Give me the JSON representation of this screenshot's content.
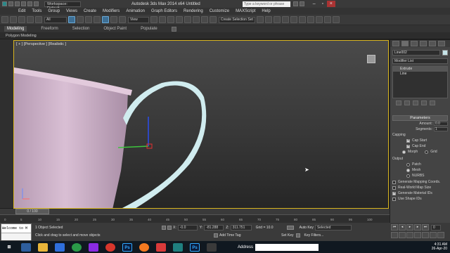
{
  "window": {
    "workspace": "Workspace: Default",
    "title": "Autodesk 3ds Max 2014 x64     Untitled",
    "search_placeholder": "Type a keyword or phrase"
  },
  "menu": [
    "Edit",
    "Tools",
    "Group",
    "Views",
    "Create",
    "Modifiers",
    "Animation",
    "Graph Editors",
    "Rendering",
    "Customize",
    "MAXScript",
    "Help"
  ],
  "toolbar": {
    "selection_filter": "All",
    "ref_coord": "View",
    "named_selection": "Create Selection Set"
  },
  "ribbon": {
    "tabs": [
      "Modeling",
      "Freeform",
      "Selection",
      "Object Paint",
      "Populate"
    ],
    "active_tab": "Modeling",
    "sub_label": "Polygon Modeling"
  },
  "viewport": {
    "label": "[ + ] [Perspective ] [Realistic ]"
  },
  "command_panel": {
    "object_name": "Line002",
    "swatch_color": "#c6e4e8",
    "modifier_list": "Modifier List",
    "stack": [
      {
        "label": "Extrude",
        "selected": true
      },
      {
        "label": "Line",
        "selected": false
      }
    ],
    "parameters": {
      "header": "Parameters",
      "amount_label": "Amount:",
      "amount_value": "0.0",
      "segments_label": "Segments:",
      "segments_value": "1",
      "capping_label": "Capping",
      "cap_start": "Cap Start",
      "cap_end": "Cap End",
      "morph": "Morph",
      "grid": "Grid",
      "output_label": "Output",
      "patch": "Patch",
      "mesh": "Mesh",
      "nurbs": "NURBS",
      "gen_mapping": "Generate Mapping Coords.",
      "real_world": "Real-World Map Size",
      "gen_material": "Generate Material IDs",
      "use_shape": "Use Shape IDs"
    }
  },
  "timeline": {
    "frame": "0 / 100",
    "ticks": [
      "0",
      "5",
      "10",
      "15",
      "20",
      "25",
      "30",
      "35",
      "40",
      "45",
      "50",
      "55",
      "60",
      "65",
      "70",
      "75",
      "80",
      "85",
      "90",
      "95",
      "100"
    ]
  },
  "status": {
    "maxscript_text": "Welcome to M",
    "selected": "1 Object Selected",
    "prompt": "Click and drag to select and move objects",
    "x_label": "X:",
    "x_value": "-0.0",
    "y_label": "Y:",
    "y_value": "-81.288",
    "z_label": "Z:",
    "z_value": "311.751",
    "grid": "Grid = 10.0",
    "add_time_tag": "Add Time Tag",
    "auto_key": "Auto Key",
    "set_key": "Set Key",
    "selected_dropdown": "Selected",
    "key_filters": "Key Filters...",
    "frame_field": "0"
  },
  "taskbar": {
    "address_label": "Address",
    "time": "4:31 AM",
    "date": "26-Apr-20"
  }
}
